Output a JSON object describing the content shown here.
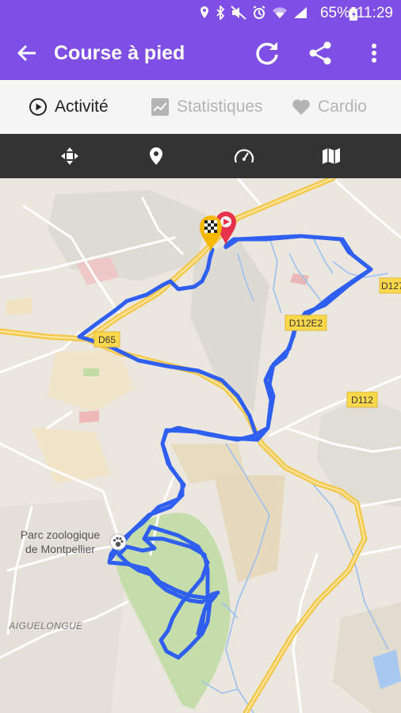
{
  "status_bar": {
    "battery_percent": "65%",
    "time": "11:29"
  },
  "app_bar": {
    "title": "Course à pied"
  },
  "tabs": [
    {
      "label": "Activité",
      "active": true
    },
    {
      "label": "Statistiques",
      "active": false
    },
    {
      "label": "Cardio",
      "active": false
    }
  ],
  "map": {
    "road_labels": {
      "d65": "D65",
      "d112e2": "D112E2",
      "d112": "D112",
      "d127": "D127"
    },
    "place_labels": {
      "zoo_line1": "Parc zoologique",
      "zoo_line2": "de Montpellier",
      "aiguelongue": "AIGUELONGUE"
    }
  },
  "colors": {
    "accent": "#7f4fe5",
    "route": "#2f5ff0",
    "toolbar": "#333333",
    "road_major": "#f4c84b",
    "park": "#c5dcab",
    "water": "#a8c8f0"
  }
}
